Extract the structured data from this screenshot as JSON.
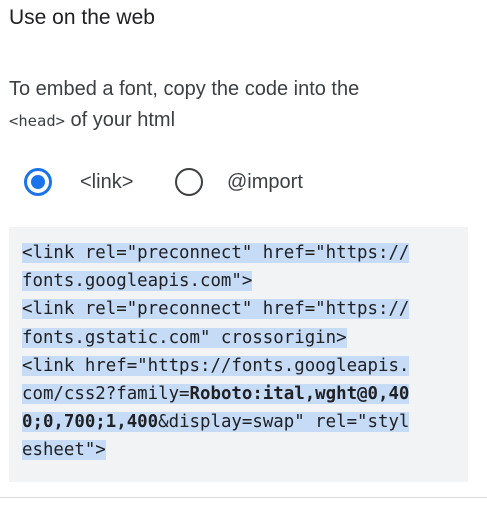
{
  "section": {
    "title": "Use on the web",
    "desc_prefix": "To embed a font, copy the code into the",
    "desc_code": "<head>",
    "desc_suffix": " of your html"
  },
  "embed_options": [
    {
      "label": "<link>",
      "selected": true
    },
    {
      "label": "@import",
      "selected": false
    }
  ],
  "code": {
    "lines": [
      "<link rel=\"preconnect\" href=\"https://",
      "fonts.googleapis.com\">",
      "<link rel=\"preconnect\" href=\"https://",
      "fonts.gstatic.com\" crossorigin>",
      "<link href=\"https://fonts.googleapis.",
      "com/css2?family=",
      "Roboto:ital,wght@0,40",
      "0;0,700;1,400",
      "&display=swap\" rel=\"styl",
      "esheet\">"
    ]
  },
  "colors": {
    "accent": "#1a73e8",
    "code_background": "#f1f3f4",
    "selection_highlight": "#c6dbf5"
  }
}
